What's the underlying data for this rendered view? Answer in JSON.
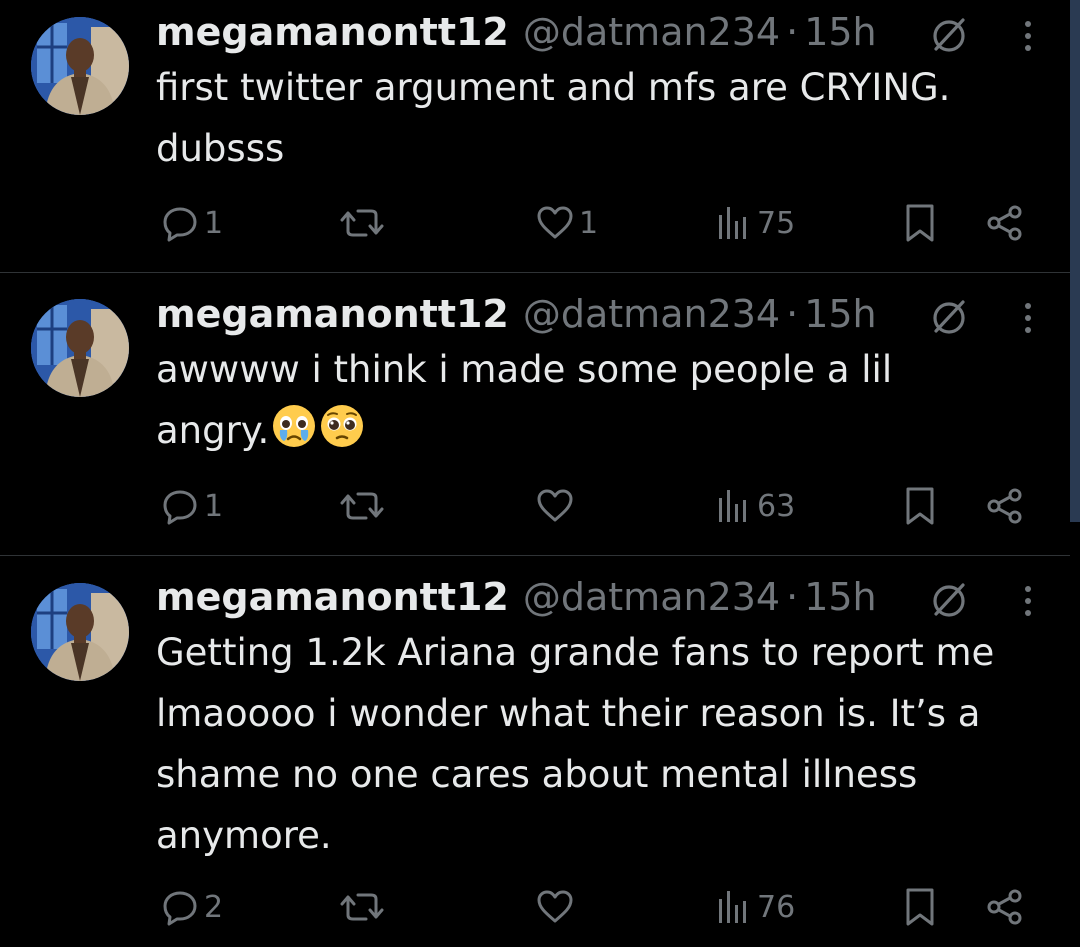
{
  "theme": {
    "background": "#000000",
    "text_primary": "#e7e9ea",
    "text_secondary": "#71767b",
    "divider": "#2f3336"
  },
  "tweets": [
    {
      "display_name": "megamanontt12",
      "handle": "@datman234",
      "separator": "·",
      "time": "15h",
      "text": "first twitter argument and mfs are CRYING.\ndubsss",
      "emojis": [],
      "replies": "1",
      "reposts": "",
      "likes": "1",
      "views": "75"
    },
    {
      "display_name": "megamanontt12",
      "handle": "@datman234",
      "separator": "·",
      "time": "15h",
      "text": "awwww i think i made some people a lil\nangry.",
      "emojis": [
        "crying-face-emoji",
        "pleading-face-emoji"
      ],
      "replies": "1",
      "reposts": "",
      "likes": "",
      "views": "63"
    },
    {
      "display_name": "megamanontt12",
      "handle": "@datman234",
      "separator": "·",
      "time": "15h",
      "text": "Getting 1.2k Ariana grande fans to report me\nlmaoooo i wonder what their reason is. It’s a\nshame no one cares about mental illness\nanymore.",
      "emojis": [],
      "replies": "2",
      "reposts": "",
      "likes": "",
      "views": "76"
    }
  ]
}
